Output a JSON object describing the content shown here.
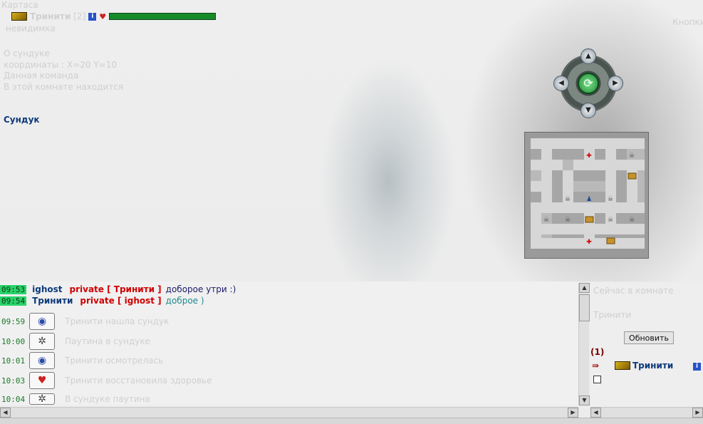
{
  "location": {
    "title": "Картаса",
    "player": {
      "name": "Тринити",
      "level": "[2]",
      "hp_fraction": 1.0
    },
    "status": "невидимка",
    "info_lines": [
      "О сундуке",
      "координаты : X=20 Y=10",
      "Данная команда",
      "В этой комнате находится"
    ],
    "chest_link": "Сундук",
    "top_right": "Кнопки"
  },
  "chat": {
    "messages": [
      {
        "time": "09:53",
        "time_highlight": true,
        "nick": "ighost",
        "private": "private [ Тринити ]",
        "text": "доборое утри :)"
      },
      {
        "time": "09:54",
        "time_highlight": true,
        "nick": "Тринити",
        "private": "private [ ighost ]",
        "text": "доброе )"
      },
      {
        "time": "09:59",
        "icon": "magnifier-icon",
        "text": "Тринити нашла сундук"
      },
      {
        "time": "10:00",
        "icon": "spiderweb-icon",
        "text": "Паутина в сундуке"
      },
      {
        "time": "10:01",
        "icon": "magnifier-icon",
        "text": "Тринити осмотрелась"
      },
      {
        "time": "10:03",
        "icon": "heart-icon",
        "text": "Тринити восстановила здоровье"
      },
      {
        "time": "10:04",
        "icon": "spiderweb-icon",
        "text": "В сундуке паутина"
      }
    ]
  },
  "right_panel": {
    "faded_lines": [
      "Сейчас в комнате",
      "Тринити"
    ],
    "refresh_label": "Обновить",
    "count": "(1)",
    "user_name": "Тринити"
  }
}
